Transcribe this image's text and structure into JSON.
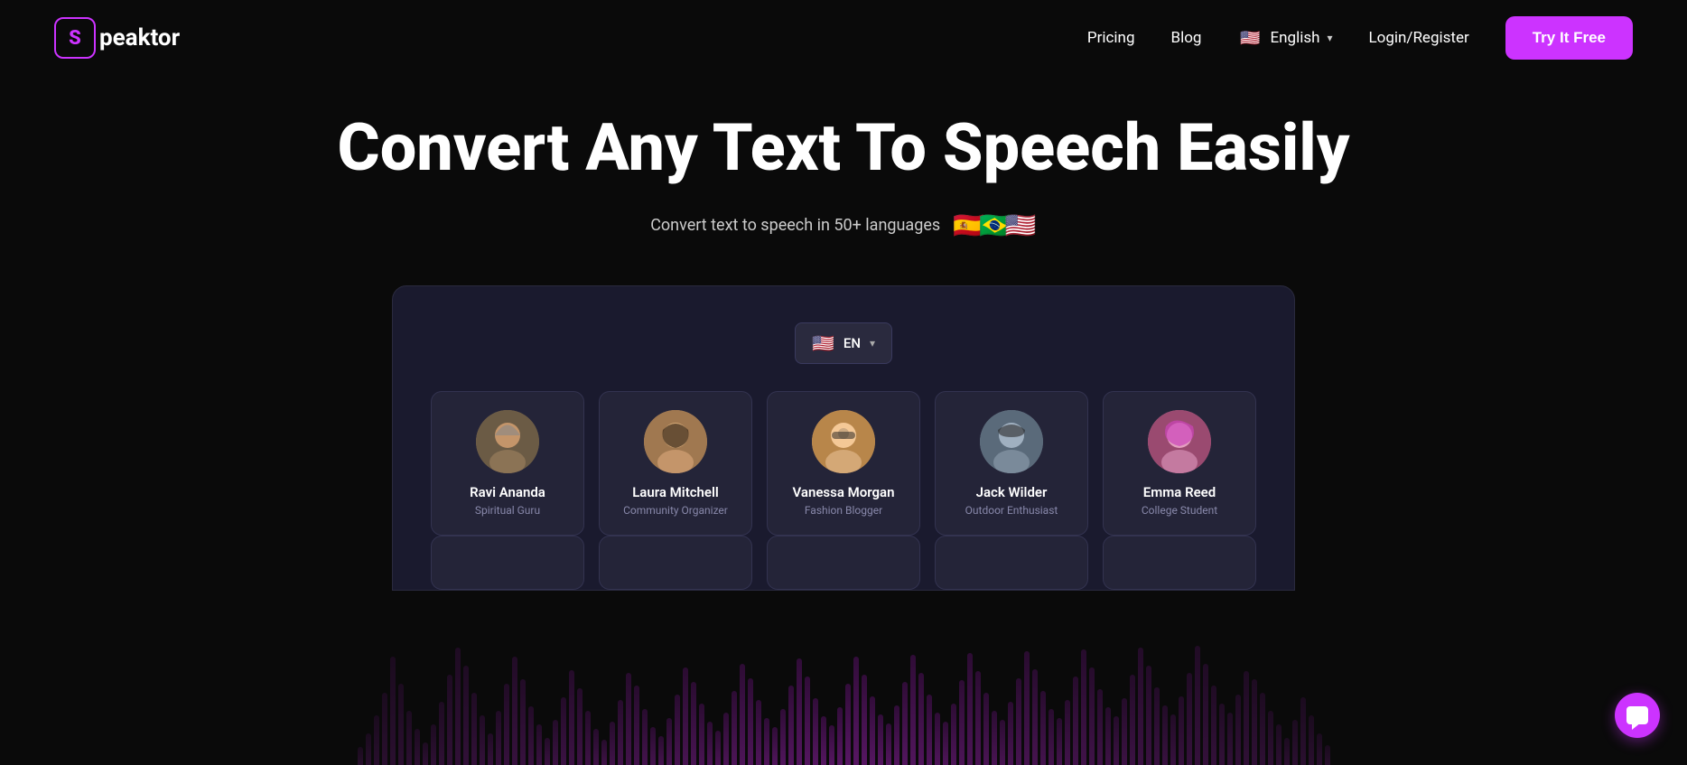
{
  "brand": {
    "logo_letter": "S",
    "logo_name": "peaktor",
    "full_name": "Speaktor"
  },
  "nav": {
    "pricing_label": "Pricing",
    "blog_label": "Blog",
    "language_label": "English",
    "login_label": "Login/Register",
    "cta_label": "Try It Free",
    "language_flag": "🇺🇸"
  },
  "hero": {
    "title": "Convert Any Text To Speech Easily",
    "subtitle": "Convert text to speech in 50+ languages",
    "flags": [
      "🇪🇸",
      "🇧🇷",
      "🇺🇸"
    ]
  },
  "app": {
    "lang_selector": {
      "flag": "🇺🇸",
      "label": "EN"
    },
    "voice_cards": [
      {
        "name": "Ravi Ananda",
        "role": "Spiritual Guru",
        "avatar_class": "avatar-ravi",
        "avatar_emoji": "👴"
      },
      {
        "name": "Laura Mitchell",
        "role": "Community Organizer",
        "avatar_class": "avatar-laura",
        "avatar_emoji": "👩"
      },
      {
        "name": "Vanessa Morgan",
        "role": "Fashion Blogger",
        "avatar_class": "avatar-vanessa",
        "avatar_emoji": "👩‍🦱"
      },
      {
        "name": "Jack Wilder",
        "role": "Outdoor Enthusiast",
        "avatar_class": "avatar-jack",
        "avatar_emoji": "👨"
      },
      {
        "name": "Emma Reed",
        "role": "College Student",
        "avatar_class": "avatar-emma",
        "avatar_emoji": "👩‍🦰"
      }
    ]
  },
  "chat": {
    "icon_label": "chat-support-icon"
  }
}
